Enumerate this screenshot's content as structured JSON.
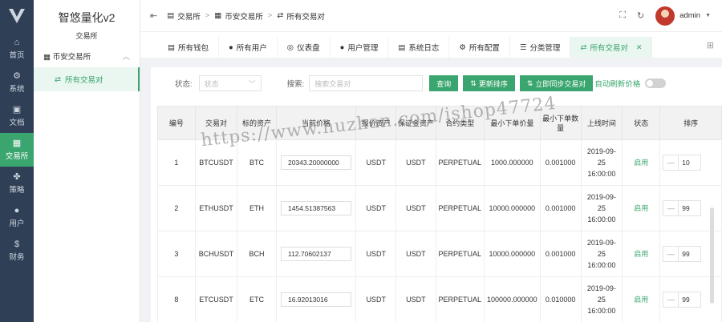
{
  "brand": {
    "title": "智悠量化v2",
    "subtitle": "交易所"
  },
  "rail": [
    {
      "label": "首页",
      "icon": "home-icon",
      "glyph": "⌂"
    },
    {
      "label": "系统",
      "icon": "gear-icon",
      "glyph": "⚙"
    },
    {
      "label": "文档",
      "icon": "book-icon",
      "glyph": "▣"
    },
    {
      "label": "交易所",
      "icon": "grid-icon",
      "glyph": "▦"
    },
    {
      "label": "策略",
      "icon": "apps-icon",
      "glyph": "✤"
    },
    {
      "label": "用户",
      "icon": "user-icon",
      "glyph": "●"
    },
    {
      "label": "财务",
      "icon": "coin-icon",
      "glyph": "$"
    }
  ],
  "submenu": {
    "group": "币安交易所",
    "item": "所有交易对"
  },
  "breadcrumb": [
    "交易所",
    "币安交易所",
    "所有交易对"
  ],
  "header": {
    "user": "admin"
  },
  "tabs": [
    {
      "label": "所有钱包",
      "glyph": "▤"
    },
    {
      "label": "所有用户",
      "glyph": "●"
    },
    {
      "label": "仪表盘",
      "glyph": "◎"
    },
    {
      "label": "用户管理",
      "glyph": "●"
    },
    {
      "label": "系统日志",
      "glyph": "▤"
    },
    {
      "label": "所有配置",
      "glyph": "⚙"
    },
    {
      "label": "分类管理",
      "glyph": "☰"
    },
    {
      "label": "所有交易对",
      "glyph": "⇄"
    }
  ],
  "filter": {
    "status_label": "状态:",
    "status_placeholder": "状态",
    "search_label": "搜索:",
    "search_placeholder": "搜索交易对",
    "query_btn": "查询",
    "update_btn": "更新排序",
    "sync_btn": "立即同步交易对",
    "auto_label": "自动刷新价格"
  },
  "table": {
    "headers": [
      "编号",
      "交易对",
      "标的资产",
      "当前价格",
      "报价资产",
      "保证金资产",
      "合约类型",
      "最小下单价量",
      "最小下单数量",
      "上线时间",
      "状态",
      "排序"
    ],
    "rows": [
      {
        "id": "1",
        "pair": "BTCUSDT",
        "base": "BTC",
        "price": "20343.20000000",
        "quote": "USDT",
        "margin": "USDT",
        "type": "PERPETUAL",
        "min_price": "1000.000000",
        "min_qty": "0.001000",
        "online": "2019-09-25 16:00:00",
        "status": "启用",
        "sort": "10"
      },
      {
        "id": "2",
        "pair": "ETHUSDT",
        "base": "ETH",
        "price": "1454.51387563",
        "quote": "USDT",
        "margin": "USDT",
        "type": "PERPETUAL",
        "min_price": "10000.000000",
        "min_qty": "0.001000",
        "online": "2019-09-25 16:00:00",
        "status": "启用",
        "sort": "99"
      },
      {
        "id": "3",
        "pair": "BCHUSDT",
        "base": "BCH",
        "price": "112.70602137",
        "quote": "USDT",
        "margin": "USDT",
        "type": "PERPETUAL",
        "min_price": "10000.000000",
        "min_qty": "0.001000",
        "online": "2019-09-25 16:00:00",
        "status": "启用",
        "sort": "99"
      },
      {
        "id": "8",
        "pair": "ETCUSDT",
        "base": "ETC",
        "price": "16.92013016",
        "quote": "USDT",
        "margin": "USDT",
        "type": "PERPETUAL",
        "min_price": "100000.000000",
        "min_qty": "0.010000",
        "online": "2019-09-25 16:00:00",
        "status": "启用",
        "sort": "99"
      }
    ]
  },
  "watermark": "https://www.huzhan.com/ishop47724",
  "colors": {
    "accent": "#3aa56e",
    "rail": "#2f4056"
  }
}
